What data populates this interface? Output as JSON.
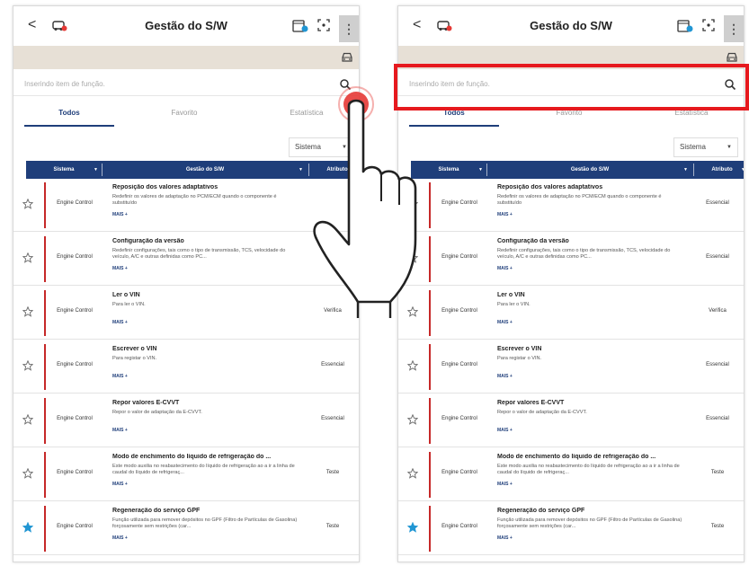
{
  "left_panel": {
    "title": "Gestão do S/W",
    "back_glyph": "<",
    "more_glyph": "⋮",
    "search_placeholder": "Inserindo item de função.",
    "tabs": [
      {
        "label": "Todos",
        "active": true
      },
      {
        "label": "Favorito",
        "active": false
      },
      {
        "label": "Estatística",
        "active": false
      }
    ],
    "filter_value": "Sistema",
    "columns": [
      "Sistema",
      "Gestão do S/W",
      "Atributo"
    ],
    "rows": [
      {
        "favorite": false,
        "system": "Engine Control",
        "name": "Reposição dos valores adaptativos",
        "desc": "Redefinir os valores de adaptação no PCM/ECM quando o componente é substituído",
        "more": "MAIS +",
        "attribute": ""
      },
      {
        "favorite": false,
        "system": "Engine Control",
        "name": "Configuração da versão",
        "desc": "Redefinir configurações, tais como o tipo de transmissão, TCS, velocidade do veículo, A/C e outras definidas como PC...",
        "more": "MAIS +",
        "attribute": "Es"
      },
      {
        "favorite": false,
        "system": "Engine Control",
        "name": "Ler o VIN",
        "desc": "Para ler o VIN.",
        "more": "MAIS +",
        "attribute": "Verifica"
      },
      {
        "favorite": false,
        "system": "Engine Control",
        "name": "Escrever o VIN",
        "desc": "Para registar o VIN.",
        "more": "MAIS +",
        "attribute": "Essencial"
      },
      {
        "favorite": false,
        "system": "Engine Control",
        "name": "Repor valores E-CVVT",
        "desc": "Repor o valor de adaptação da E-CVVT.",
        "more": "MAIS +",
        "attribute": "Essencial"
      },
      {
        "favorite": false,
        "system": "Engine Control",
        "name": "Modo de enchimento do líquido de refrigeração do ...",
        "desc": "Este modo auxilia no reabastecimento do líquido de refrigeração ao a ir a linha de caudal do líquido de refrigeraç...",
        "more": "MAIS +",
        "attribute": "Teste"
      },
      {
        "favorite": true,
        "system": "Engine Control",
        "name": "Regeneração do serviço GPF",
        "desc": "Função utilizada para remover depósitos no GPF (Filtro de Partículas de Gasolina) forçosamente sem restrições (car...",
        "more": "MAIS +",
        "attribute": "Teste"
      }
    ]
  },
  "right_panel": {
    "title": "Gestão do S/W",
    "back_glyph": "<",
    "more_glyph": "⋮",
    "search_placeholder": "Inserindo item de função.",
    "tabs": [
      {
        "label": "Todos",
        "active": true
      },
      {
        "label": "Favorito",
        "active": false
      },
      {
        "label": "Estatística",
        "active": false
      }
    ],
    "filter_value": "Sistema",
    "columns": [
      "Sistema",
      "Gestão do S/W",
      "Atributo"
    ],
    "rows": [
      {
        "favorite": false,
        "system": "Engine Control",
        "name": "Reposição dos valores adaptativos",
        "desc": "Redefinir os valores de adaptação no PCM/ECM quando o componente é substituído",
        "more": "MAIS +",
        "attribute": "Essencial"
      },
      {
        "favorite": false,
        "system": "Engine Control",
        "name": "Configuração da versão",
        "desc": "Redefinir configurações, tais como o tipo de transmissão, TCS, velocidade do veículo, A/C e outras definidas como PC...",
        "more": "MAIS +",
        "attribute": "Essencial"
      },
      {
        "favorite": false,
        "system": "Engine Control",
        "name": "Ler o VIN",
        "desc": "Para ler o VIN.",
        "more": "MAIS +",
        "attribute": "Verifica"
      },
      {
        "favorite": false,
        "system": "Engine Control",
        "name": "Escrever o VIN",
        "desc": "Para registar o VIN.",
        "more": "MAIS +",
        "attribute": "Essencial"
      },
      {
        "favorite": false,
        "system": "Engine Control",
        "name": "Repor valores E-CVVT",
        "desc": "Repor o valor de adaptação da E-CVVT.",
        "more": "MAIS +",
        "attribute": "Essencial"
      },
      {
        "favorite": false,
        "system": "Engine Control",
        "name": "Modo de enchimento do líquido de refrigeração do ...",
        "desc": "Este modo auxilia no reabastecimento do líquido de refrigeração ao a ir a linha de caudal do líquido de refrigeraç...",
        "more": "MAIS +",
        "attribute": "Teste"
      },
      {
        "favorite": true,
        "system": "Engine Control",
        "name": "Regeneração do serviço GPF",
        "desc": "Função utilizada para remover depósitos no GPF (Filtro de Partículas de Gasolina) forçosamente sem restrições (car...",
        "more": "MAIS +",
        "attribute": "Teste"
      }
    ]
  },
  "colors": {
    "header_blue": "#1f3e7a",
    "row_marker_red": "#c62828",
    "highlight_red": "#e6191e",
    "tap_red": "#e53935",
    "favorite_blue": "#2196d3",
    "vehicle_strip": "#e7e0d6"
  },
  "icons": {
    "back": "chevron-left-icon",
    "vehicle": "car-icon",
    "calendar": "calendar-icon",
    "scan": "scan-icon",
    "more": "more-vertical-icon",
    "search": "search-icon",
    "favorite": "star-icon"
  }
}
